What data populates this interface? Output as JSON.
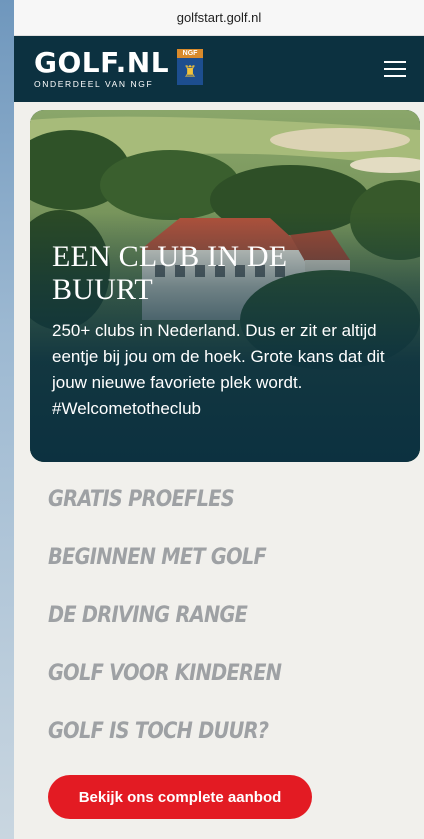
{
  "browser": {
    "url": "golfstart.golf.nl"
  },
  "header": {
    "logo_main": "GOLF.NL",
    "logo_sub": "ONDERDEEL VAN NGF",
    "badge": "NGF"
  },
  "hero": {
    "title": "EEN CLUB IN DE BUURT",
    "text": "250+ clubs in Nederland. Dus er zit er altijd eentje bij jou om de hoek. Grote kans dat dit jouw nieuwe favoriete plek wordt. #Welcometotheclub"
  },
  "links": [
    {
      "label": "GRATIS PROEFLES"
    },
    {
      "label": "BEGINNEN MET GOLF"
    },
    {
      "label": "DE DRIVING RANGE"
    },
    {
      "label": "GOLF VOOR KINDEREN"
    },
    {
      "label": "GOLF IS TOCH DUUR?"
    }
  ],
  "cta": {
    "label": "Bekijk ons complete aanbod"
  },
  "colors": {
    "header_bg": "#0c3140",
    "link_gray": "#9ea1a4",
    "cta_red": "#e31b23",
    "page_bg": "#f1f0ec"
  },
  "icons": {
    "menu": "hamburger-menu-icon",
    "badge": "ngf-lion-shield-icon"
  }
}
